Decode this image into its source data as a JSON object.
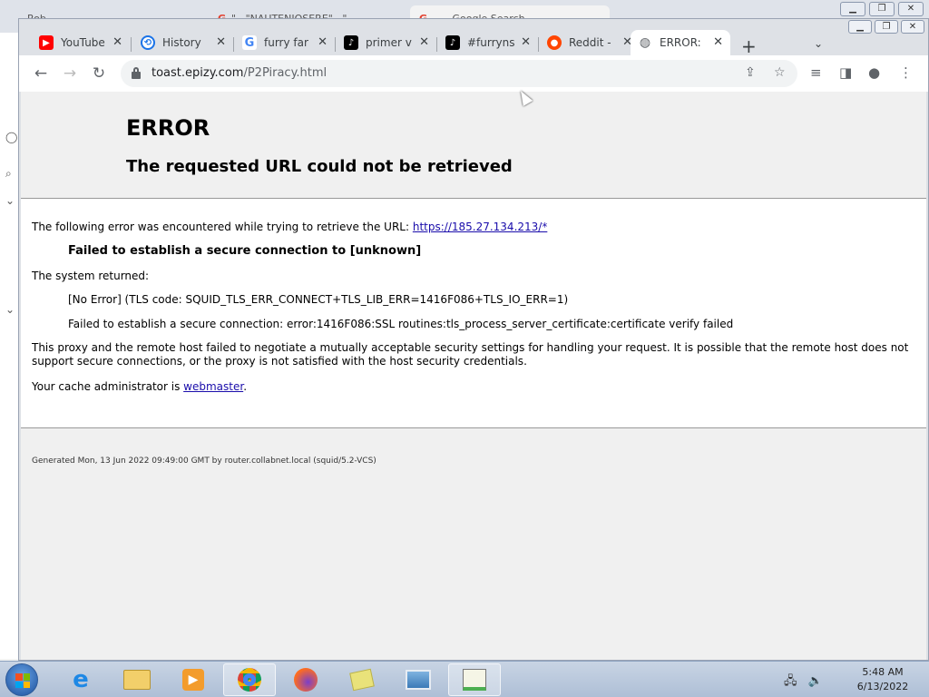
{
  "background_window": {
    "tabs": [
      "Rob",
      "\"...\"NAUTENIOSERE\"...\"",
      "... - Google Search ..."
    ]
  },
  "tabs": [
    {
      "label": "YouTube",
      "icon": "youtube-icon",
      "color": "#ff0000"
    },
    {
      "label": "History",
      "icon": "history-icon",
      "color": "#1a73e8"
    },
    {
      "label": "furry far",
      "icon": "google-icon",
      "color": "#4285f4"
    },
    {
      "label": "primer v",
      "icon": "tiktok-icon",
      "color": "#000000"
    },
    {
      "label": "#furryns",
      "icon": "tiktok-icon",
      "color": "#000000"
    },
    {
      "label": "Reddit -",
      "icon": "reddit-icon",
      "color": "#ff4500"
    },
    {
      "label": "ERROR:",
      "icon": "globe-icon",
      "color": "#5f6368",
      "active": true
    }
  ],
  "address": {
    "domain": "toast.epizy.com",
    "path": "/P2Piracy.html"
  },
  "page": {
    "title": "ERROR",
    "subtitle": "The requested URL could not be retrieved",
    "intro_text": "The following error was encountered while trying to retrieve the URL: ",
    "intro_link": "https://185.27.134.213/*",
    "failure": "Failed to establish a secure connection to [unknown]",
    "system_returned": "The system returned:",
    "error_code": "[No Error] (TLS code: SQUID_TLS_ERR_CONNECT+TLS_LIB_ERR=1416F086+TLS_IO_ERR=1)",
    "error_detail": "Failed to establish a secure connection: error:1416F086:SSL routines:tls_process_server_certificate:certificate verify failed",
    "explanation": "This proxy and the remote host failed to negotiate a mutually acceptable security settings for handling your request. It is possible that the remote host does not support secure connections, or the proxy is not satisfied with the host security credentials.",
    "admin_text": "Your cache administrator is ",
    "admin_link": "webmaster",
    "admin_end": ".",
    "footer": "Generated Mon, 13 Jun 2022 09:49:00 GMT by router.collabnet.local (squid/5.2-VCS)"
  },
  "taskbar": {
    "apps": [
      "internet-explorer-icon",
      "file-explorer-icon",
      "media-player-icon",
      "chrome-icon",
      "firefox-icon",
      "sticky-notes-icon",
      "photo-viewer-icon",
      "paint-icon"
    ],
    "time": "5:48 AM",
    "date": "6/13/2022"
  }
}
